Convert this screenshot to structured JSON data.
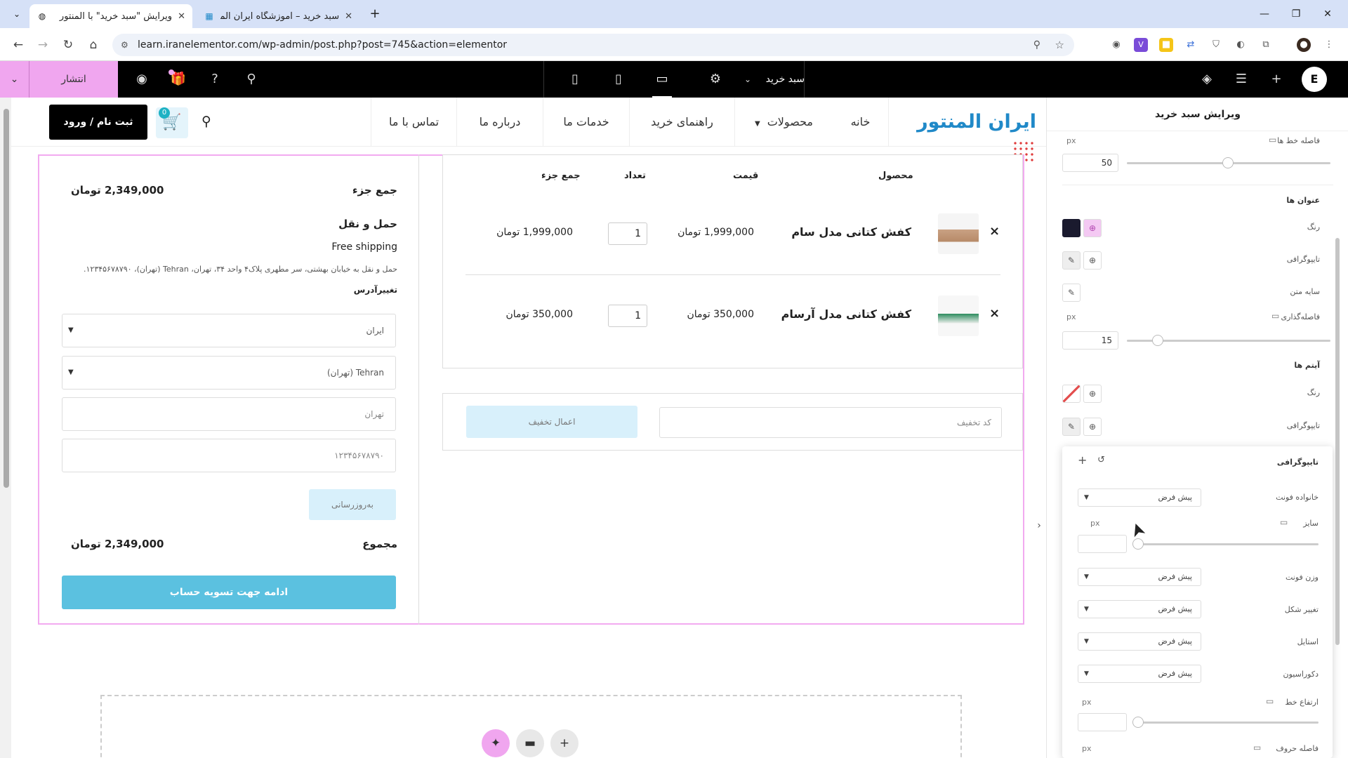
{
  "browser": {
    "tabs": [
      {
        "title": "ویرایش \"سبد خرید\" با المنتور",
        "active": true
      },
      {
        "title": "سبد خرید – آموزشگاه ایران المنتور",
        "active": false
      }
    ],
    "url": "learn.iranelementor.com/wp-admin/post.php?post=745&action=elementor"
  },
  "topbar": {
    "publish_label": "انتشار",
    "document_name": "سبد خرید"
  },
  "site": {
    "logo_text": "ایران المنتور",
    "nav": [
      "خانه",
      "محصولات",
      "راهنمای خرید",
      "خدمات ما",
      "درباره ما",
      "تماس با ما"
    ],
    "signin_label": "ثبت نام / ورود",
    "cart_count": "0"
  },
  "cart": {
    "headers": {
      "product": "محصول",
      "price": "قیمت",
      "quantity": "تعداد",
      "subtotal": "جمع جزء"
    },
    "items": [
      {
        "name": "کفش کتانی مدل سام",
        "price": "1,999,000 تومان",
        "qty": "1",
        "subtotal": "1,999,000 تومان"
      },
      {
        "name": "کفش کتانی مدل آرسام",
        "price": "350,000 تومان",
        "qty": "1",
        "subtotal": "350,000 تومان"
      }
    ],
    "coupon_placeholder": "کد تخفیف",
    "apply_coupon_label": "اعمال تخفیف"
  },
  "totals": {
    "subtotal_label": "جمع جزء",
    "subtotal_value": "2,349,000 تومان",
    "shipping_label": "حمل و نقل",
    "shipping_method": "Free shipping",
    "shipping_to": "حمل و نقل به خیابان بهشتی، سر مطهری پلاک۴ واحد ۳۴، تهران، Tehran (تهران)، ۱۲۳۴۵۶۷۸۷۹۰.",
    "change_address": "تغییرآدرس",
    "country": "ایران",
    "state": "Tehran (تهران)",
    "city": "تهران",
    "postcode": "۱۲۳۴۵۶۷۸۷۹۰",
    "update_label": "به‌روزرسانی",
    "total_label": "مجموع",
    "total_value": "2,349,000 تومان",
    "checkout_label": "ادامه جهت تسویه حساب"
  },
  "panel": {
    "title": "ویرایش سبد خرید",
    "line_spacing_label": "فاصله خط ها",
    "line_spacing_value": "50",
    "unit": "px",
    "headings_section": "عنوان ها",
    "color_label": "رنگ",
    "typography_label": "تایپوگرافی",
    "text_shadow_label": "سایه متن",
    "spacing_label": "فاصله‌گذاری",
    "spacing_value": "15",
    "items_section": "آیتم ها",
    "typography_popup": {
      "title": "تایپوگرافی",
      "font_family_label": "خانواده فونت",
      "size_label": "سایز",
      "font_weight_label": "وزن فونت",
      "transform_label": "تغییر شکل",
      "style_label": "استایل",
      "decoration_label": "دکوراسیون",
      "line_height_label": "ارتفاع خط",
      "letter_spacing_label": "فاصله حروف",
      "default": "پیش فرض"
    }
  },
  "colors": {
    "accent_pink": "#f0a6ef",
    "button_blue": "#5bc1e0",
    "logo_blue": "#2089c8"
  }
}
